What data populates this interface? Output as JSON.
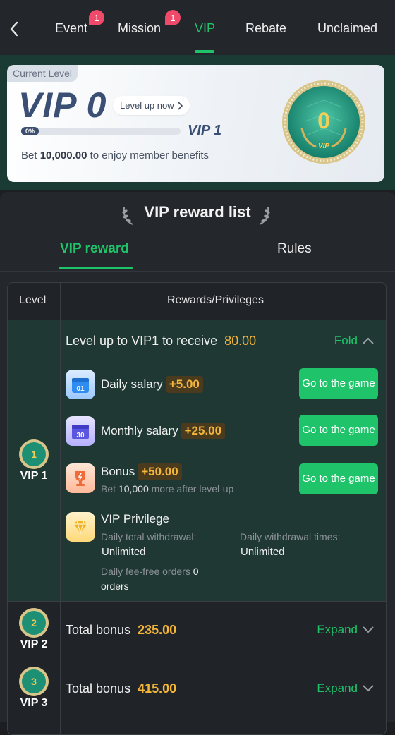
{
  "topnav": {
    "tabs": [
      {
        "label": "Event",
        "badge": "1"
      },
      {
        "label": "Mission",
        "badge": "1"
      },
      {
        "label": "VIP"
      },
      {
        "label": "Rebate"
      },
      {
        "label": "Unclaimed"
      }
    ],
    "active_tab": "VIP"
  },
  "level_card": {
    "tag": "Current Level",
    "current": "VIP 0",
    "level_up_label": "Level up now",
    "progress_label": "0%",
    "progress": 0,
    "next_level": "VIP 1",
    "bet_prefix": "Bet",
    "bet_amount": "10,000.00",
    "bet_suffix": "to enjoy member benefits",
    "medal_number": "0",
    "medal_text": "VIP"
  },
  "reward_list": {
    "title": "VIP reward list",
    "tabs": [
      "VIP reward",
      "Rules"
    ],
    "active_tab": "VIP reward"
  },
  "table": {
    "col_level": "Level",
    "col_rewards": "Rewards/Privileges",
    "vip1": {
      "level": "VIP 1",
      "medal_number": "1",
      "header_text": "Level up to VIP1 to receive",
      "header_amount": "80.00",
      "fold_label": "Fold",
      "items": [
        {
          "icon": "calendar-01-icon",
          "day": "01",
          "label": "Daily salary",
          "amount": "+5.00",
          "button": "Go to the game"
        },
        {
          "icon": "calendar-30-icon",
          "day": "30",
          "label": "Monthly salary",
          "amount": "+25.00",
          "button": "Go to the game"
        },
        {
          "icon": "trophy-icon",
          "label": "Bonus",
          "amount": "+50.00",
          "button": "Go to the game",
          "sub_prefix": "Bet",
          "sub_amount": "10,000",
          "sub_suffix": "more after level-up"
        }
      ],
      "privilege": {
        "icon": "diamond-icon",
        "title": "VIP Privilege",
        "daily_total_withdrawal_label": "Daily total withdrawal:",
        "daily_total_withdrawal_value": "Unlimited",
        "daily_withdrawal_times_label": "Daily withdrawal times:",
        "daily_withdrawal_times_value": "Unlimited",
        "fee_free_label": "Daily fee-free orders",
        "fee_free_value": "0",
        "fee_free_suffix": "orders"
      }
    },
    "vip2": {
      "level": "VIP 2",
      "medal_number": "2",
      "total_label": "Total bonus",
      "total_amount": "235.00",
      "expand_label": "Expand"
    },
    "vip3": {
      "level": "VIP 3",
      "medal_number": "3",
      "total_label": "Total bonus",
      "total_amount": "415.00",
      "expand_label": "Expand"
    }
  },
  "colors": {
    "accent": "#1fc46a",
    "gold": "#f4b63a",
    "badge": "#f04a6b",
    "background": "#1c1e22"
  }
}
